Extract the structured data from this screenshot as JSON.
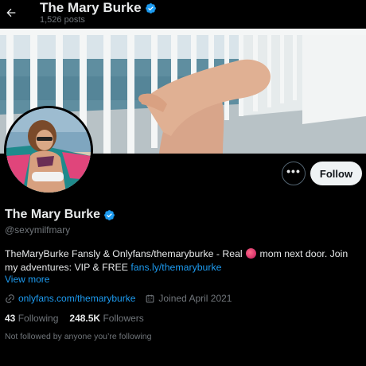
{
  "header": {
    "back_icon": "arrow-left-icon",
    "title": "The Mary Burke",
    "posts": "1,526 posts"
  },
  "banner": {
    "description_icon": "banner-photo"
  },
  "actions": {
    "more_label": "•••",
    "follow_label": "Follow"
  },
  "profile": {
    "name": "The Mary Burke",
    "handle": "@sexymilfmary",
    "verified_icon": "verified-badge-icon",
    "bio_text_1": "TheMaryBurke Fansly & Onlyfans/themaryburke - Real ",
    "bio_text_2": " mom next door. Join my adventures: VIP & FREE ",
    "bio_link": "fans.ly/themaryburke",
    "view_more": "View more",
    "website": "onlyfans.com/themaryburke",
    "joined": "Joined April 2021",
    "following_count": "43",
    "following_label": "Following",
    "followers_count": "248.5K",
    "followers_label": "Followers",
    "followed_by": "Not followed by anyone you’re following"
  },
  "colors": {
    "background": "#000000",
    "text": "#e7e9ea",
    "muted": "#71767b",
    "link": "#1d9bf0",
    "verified": "#1d9bf0"
  }
}
